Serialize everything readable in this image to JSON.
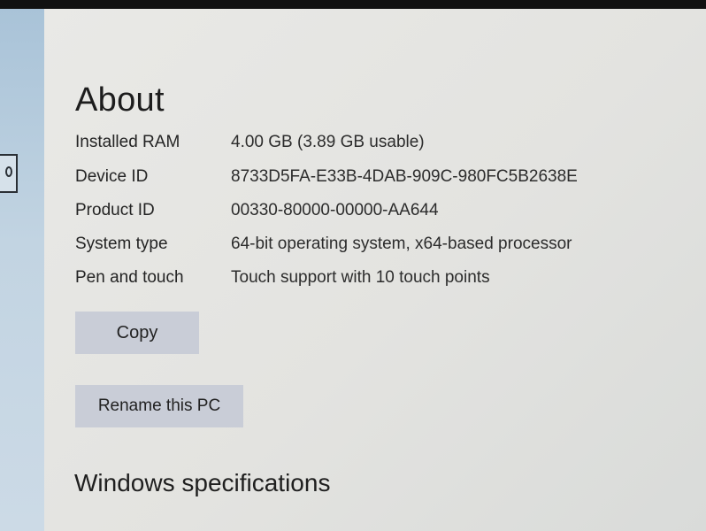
{
  "page": {
    "title": "About"
  },
  "device_specs": [
    {
      "label": "Installed RAM",
      "value": "4.00 GB (3.89 GB usable)"
    },
    {
      "label": "Device ID",
      "value": "8733D5FA-E33B-4DAB-909C-980FC5B2638E"
    },
    {
      "label": "Product ID",
      "value": "00330-80000-00000-AA644"
    },
    {
      "label": "System type",
      "value": "64-bit operating system, x64-based processor"
    },
    {
      "label": "Pen and touch",
      "value": "Touch support with 10 touch points"
    }
  ],
  "buttons": {
    "copy_label": "Copy",
    "rename_label": "Rename this PC"
  },
  "windows_specifications": {
    "heading": "Windows specifications"
  },
  "colors": {
    "button_bg": "#c9cdd7",
    "sidebar_bg": "#c2d4e2",
    "content_bg": "#e3e3e0"
  }
}
